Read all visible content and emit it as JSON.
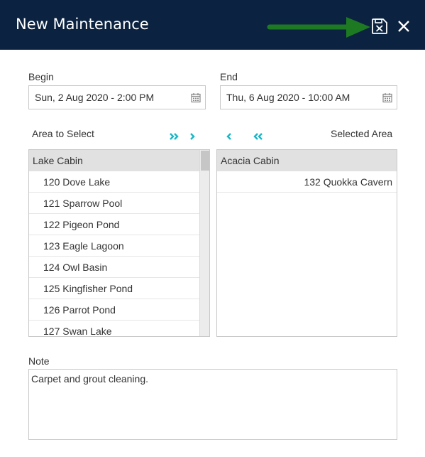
{
  "header": {
    "title": "New Maintenance",
    "background": "#0b2340",
    "save_icon": "save-cancel-icon",
    "close_icon": "close-icon",
    "annotation_arrow_color": "#1e7a22"
  },
  "dates": {
    "begin_label": "Begin",
    "begin_value": "Sun, 2 Aug 2020 - 2:00 PM",
    "end_label": "End",
    "end_value": "Thu, 6 Aug 2020 - 10:00 AM",
    "icon": "calendar-icon"
  },
  "transfer": {
    "left_title": "Area to Select",
    "right_title": "Selected Area",
    "accent": "#17b8c8",
    "available_group": "Lake Cabin",
    "available_items": [
      "120 Dove Lake",
      "121 Sparrow Pool",
      "122 Pigeon Pond",
      "123 Eagle Lagoon",
      "124 Owl Basin",
      "125 Kingfisher Pond",
      "126 Parrot Pond",
      "127 Swan Lake"
    ],
    "selected_group": "Acacia Cabin",
    "selected_items": [
      "132 Quokka Cavern"
    ]
  },
  "note": {
    "label": "Note",
    "value": "Carpet and grout cleaning."
  }
}
